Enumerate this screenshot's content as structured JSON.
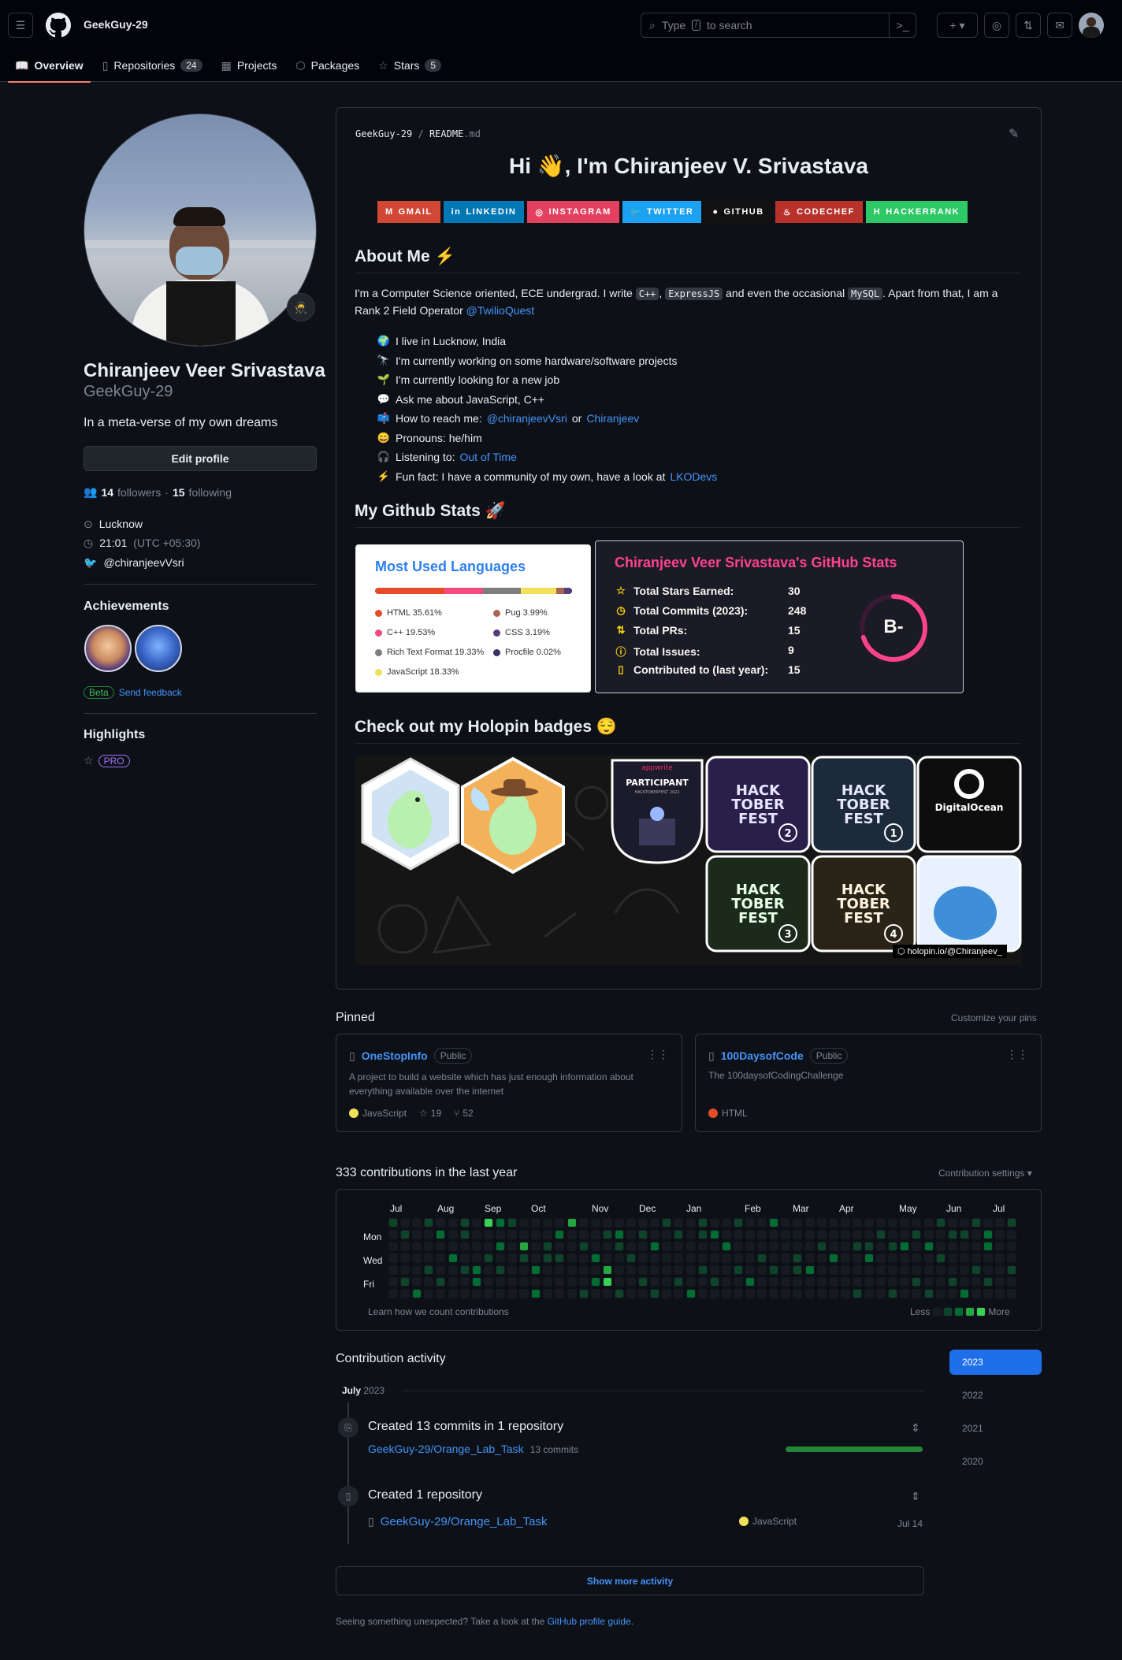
{
  "header": {
    "username": "GeekGuy-29",
    "search_placeholder": "Type / to search",
    "search_prefix": "Type",
    "search_key": "/",
    "search_suffix": "to search"
  },
  "tabs": [
    {
      "label": "Overview",
      "icon": "book-icon"
    },
    {
      "label": "Repositories",
      "count": "24",
      "icon": "repo-icon"
    },
    {
      "label": "Projects",
      "icon": "table-icon"
    },
    {
      "label": "Packages",
      "icon": "package-icon"
    },
    {
      "label": "Stars",
      "count": "5",
      "icon": "star-icon"
    }
  ],
  "profile": {
    "name": "Chiranjeev Veer Srivastava",
    "login": "GeekGuy-29",
    "bio": "In a meta-verse of my own dreams",
    "edit_label": "Edit profile",
    "followers": "14",
    "followers_label": "followers",
    "following": "15",
    "following_label": "following",
    "location": "Lucknow",
    "time": "21:01",
    "timezone": "(UTC +05:30)",
    "twitter": "@chiranjeevVsri",
    "achievements_title": "Achievements",
    "beta": "Beta",
    "feedback": "Send feedback",
    "highlights_title": "Highlights",
    "pro": "PRO"
  },
  "readme": {
    "path_user": "GeekGuy-29",
    "path_sep": "/",
    "path_file": "README",
    "path_ext": ".md",
    "title": "Hi 👋, I'm Chiranjeev V. Srivastava",
    "badges": [
      {
        "label": "GMAIL",
        "color": "#d14836"
      },
      {
        "label": "LINKEDIN",
        "color": "#0077b5"
      },
      {
        "label": "INSTAGRAM",
        "color": "#e4405f"
      },
      {
        "label": "TWITTER",
        "color": "#1da1f2"
      },
      {
        "label": "GITHUB",
        "color": "#121011"
      },
      {
        "label": "CODECHEF",
        "color": "#b8322b"
      },
      {
        "label": "HACKERRANK",
        "color": "#2ec866"
      }
    ],
    "about_title": "About Me ⚡",
    "about_p1": "I'm a Computer Science oriented, ECE undergrad. I write",
    "code1": "C++",
    "code2": "ExpressJS",
    "about_p2": "and even the occasional",
    "code3": "MySQL",
    "about_p3": ". Apart from that, I am a Rank 2 Field Operator",
    "about_link": "@TwilioQuest",
    "list": [
      {
        "emoji": "🌍",
        "text": "I live in Lucknow, India"
      },
      {
        "emoji": "🔭",
        "text": "I'm currently working on some hardware/software projects"
      },
      {
        "emoji": "🌱",
        "text": "I'm currently looking for a new job"
      },
      {
        "emoji": "💬",
        "text": "Ask me about JavaScript, C++"
      },
      {
        "emoji": "📫",
        "text": "How to reach me:",
        "link": "@chiranjeevVsri",
        "mid": "or",
        "link2": "Chiranjeev"
      },
      {
        "emoji": "😄",
        "text": "Pronouns: he/him"
      },
      {
        "emoji": "🎧",
        "text": "Listening to:",
        "link": "Out of Time"
      },
      {
        "emoji": "⚡",
        "text": "Fun fact: I have a community of my own, have a look at",
        "link": "LKODevs"
      }
    ],
    "stats_title": "My Github Stats 🚀",
    "holopin_title": "Check out my Holopin badges 😌",
    "holopin_link": "holopin.io/@Chiranjeev_"
  },
  "languages": {
    "title": "Most Used Languages",
    "items": [
      {
        "label": "HTML 35.61%",
        "value": 35.61,
        "color": "#e34c26"
      },
      {
        "label": "Pug 3.99%",
        "value": 3.99,
        "color": "#a86454"
      },
      {
        "label": "C++ 19.53%",
        "value": 19.53,
        "color": "#f34b7d"
      },
      {
        "label": "CSS 3.19%",
        "value": 3.19,
        "color": "#563d7c"
      },
      {
        "label": "Rich Text Format 19.33%",
        "value": 19.33,
        "color": "#7d7d7d"
      },
      {
        "label": "Procfile 0.02%",
        "value": 0.02,
        "color": "#3b2f63"
      },
      {
        "label": "JavaScript 18.33%",
        "value": 18.33,
        "color": "#f1e05a"
      }
    ]
  },
  "stats": {
    "title": "Chiranjeev Veer Srivastava's GitHub Stats",
    "rank": "B-",
    "rank_progress": 0.7,
    "rows": [
      {
        "label": "Total Stars Earned:",
        "value": "30",
        "icon": "star-icon"
      },
      {
        "label": "Total Commits (2023):",
        "value": "248",
        "icon": "clock-icon"
      },
      {
        "label": "Total PRs:",
        "value": "15",
        "icon": "pull-request-icon"
      },
      {
        "label": "Total Issues:",
        "value": "9",
        "icon": "issue-icon"
      },
      {
        "label": "Contributed to (last year):",
        "value": "15",
        "icon": "repo-icon"
      }
    ]
  },
  "pinned": {
    "title": "Pinned",
    "customize": "Customize your pins",
    "repos": [
      {
        "name": "OneStopInfo",
        "visibility": "Public",
        "desc": "A project to build a website which has just enough information about everything available over the internet",
        "lang": "JavaScript",
        "lang_color": "#f1e05a",
        "stars": "19",
        "forks": "52"
      },
      {
        "name": "100DaysofCode",
        "visibility": "Public",
        "desc": "The 100daysofCodingChallenge",
        "lang": "HTML",
        "lang_color": "#e34c26"
      }
    ]
  },
  "contributions": {
    "title": "333 contributions in the last year",
    "settings": "Contribution settings ▾",
    "months": [
      "Jul",
      "Aug",
      "Sep",
      "Oct",
      "Nov",
      "Dec",
      "Jan",
      "Feb",
      "Mar",
      "Apr",
      "May",
      "Jun",
      "Jul"
    ],
    "days": [
      "Mon",
      "Wed",
      "Fri"
    ],
    "learn": "Learn how we count contributions",
    "less": "Less",
    "more": "More",
    "level_colors": [
      "#161b22",
      "#0e4429",
      "#006d32",
      "#26a641",
      "#39d353"
    ]
  },
  "activity": {
    "title": "Contribution activity",
    "month": "July",
    "year": "2023",
    "years": [
      "2023",
      "2022",
      "2021",
      "2020"
    ],
    "commits_title": "Created 13 commits in 1 repository",
    "commits_repo": "GeekGuy-29/Orange_Lab_Task",
    "commits_count": "13 commits",
    "repo_title": "Created 1 repository",
    "repo_name": "GeekGuy-29/Orange_Lab_Task",
    "repo_lang": "JavaScript",
    "repo_date": "Jul 14",
    "show_more": "Show more activity",
    "footer_text": "Seeing something unexpected? Take a look at the",
    "footer_link": "GitHub profile guide",
    "footer_end": "."
  }
}
